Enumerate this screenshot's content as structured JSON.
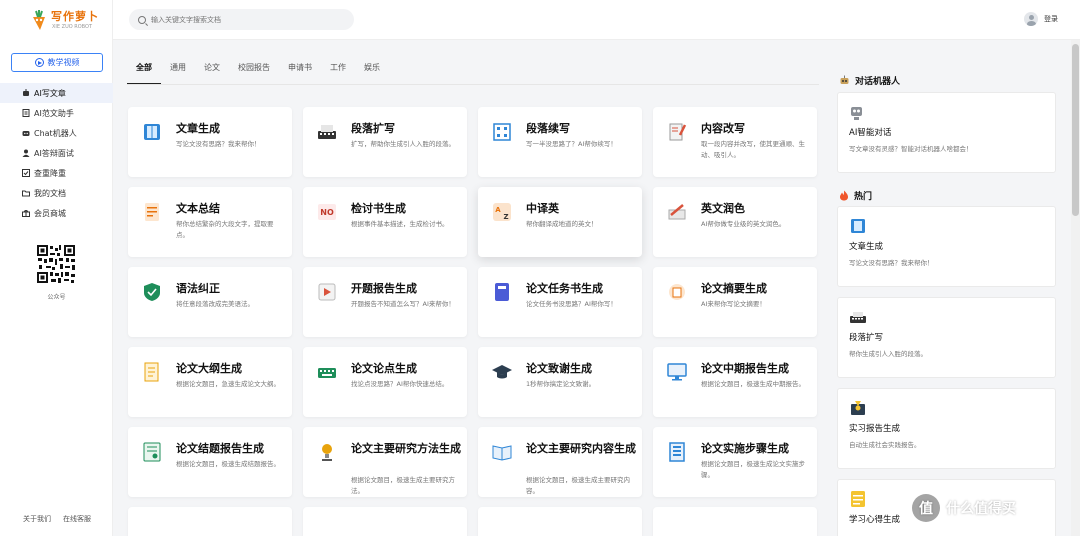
{
  "brand": {
    "title": "写作萝卜",
    "subtitle": "XIE ZUO ROBOT"
  },
  "sidebar": {
    "video_button": "教学视频",
    "items": [
      {
        "label": "AI写文章",
        "icon": "robot-icon"
      },
      {
        "label": "AI范文助手",
        "icon": "document-icon"
      },
      {
        "label": "Chat机器人",
        "icon": "chat-bot-icon"
      },
      {
        "label": "AI答辩面试",
        "icon": "user-icon"
      },
      {
        "label": "查重降重",
        "icon": "check-icon"
      },
      {
        "label": "我的文档",
        "icon": "folder-icon"
      },
      {
        "label": "会员商城",
        "icon": "gift-icon"
      }
    ],
    "qr_label": "公众号",
    "footer": {
      "about": "关于我们",
      "report": "在线客服"
    }
  },
  "topbar": {
    "search_placeholder": "输入关键文字搜索文档",
    "login": "登录"
  },
  "tabs": [
    "全部",
    "通用",
    "论文",
    "校园报告",
    "申请书",
    "工作",
    "娱乐"
  ],
  "cards": [
    {
      "title": "文章生成",
      "desc": "写论文没有思路？我来帮你！",
      "icon": "book-icon",
      "color": "#2f86d6"
    },
    {
      "title": "段落扩写",
      "desc": "扩写，帮助你生成引人入胜的段落。",
      "icon": "typewriter-icon",
      "color": "#333333"
    },
    {
      "title": "段落续写",
      "desc": "写一半没思路了？AI帮你续写！",
      "icon": "grid-icon",
      "color": "#2f86d6"
    },
    {
      "title": "内容改写",
      "desc": "取一段内容并改写，使其更通顺、生动、吸引人。",
      "icon": "edit-icon",
      "color": "#d9533c"
    },
    {
      "title": "文本总结",
      "desc": "帮你总结繁杂的大段文字，提取要点。",
      "icon": "summary-icon",
      "color": "#e8730c"
    },
    {
      "title": "检讨书生成",
      "desc": "根据事件基本描述，生成检讨书。",
      "icon": "no-icon",
      "color": "#c0392b"
    },
    {
      "title": "中译英",
      "desc": "帮你翻译成地道的英文！",
      "icon": "translate-icon",
      "color": "#e8730c"
    },
    {
      "title": "英文润色",
      "desc": "AI帮你做专业级的英文润色。",
      "icon": "pen-paper-icon",
      "color": "#555555"
    },
    {
      "title": "语法纠正",
      "desc": "将任意段落改成完美语法。",
      "icon": "shield-icon",
      "color": "#1e8e5a"
    },
    {
      "title": "开题报告生成",
      "desc": "开题报告不知道怎么写？AI来帮你！",
      "icon": "report-icon",
      "color": "#d9533c"
    },
    {
      "title": "论文任务书生成",
      "desc": "论文任务书没思路？AI帮你写！",
      "icon": "notebook-icon",
      "color": "#4b5bd6"
    },
    {
      "title": "论文摘要生成",
      "desc": "AI来帮你写论文摘要！",
      "icon": "abstract-icon",
      "color": "#e8730c"
    },
    {
      "title": "论文大纲生成",
      "desc": "根据论文题目，急速生成论文大纲。",
      "icon": "outline-icon",
      "color": "#e8a30c"
    },
    {
      "title": "论文论点生成",
      "desc": "找论点没思路？AI帮你快速总结。",
      "icon": "keyboard-icon",
      "color": "#1e8e5a"
    },
    {
      "title": "论文致谢生成",
      "desc": "1秒帮你搞定论文致谢。",
      "icon": "graduation-cap-icon",
      "color": "#2c3e50"
    },
    {
      "title": "论文中期报告生成",
      "desc": "根据论文题目，极速生成中期报告。",
      "icon": "monitor-icon",
      "color": "#2f86d6"
    },
    {
      "title": "论文结题报告生成",
      "desc": "根据论文题目，极速生成结题报告。",
      "icon": "certificate-icon",
      "color": "#1e8e5a"
    },
    {
      "title": "论文主要研究方法生成",
      "desc": "根据论文题目，极速生成主要研究方法。",
      "icon": "lamp-icon",
      "color": "#e8a30c"
    },
    {
      "title": "论文主要研究内容生成",
      "desc": "根据论文题目，极速生成主要研究内容。",
      "icon": "open-book-icon",
      "color": "#2f86d6"
    },
    {
      "title": "论文实施步骤生成",
      "desc": "根据论文题目，极速生成论文实施步骤。",
      "icon": "steps-icon",
      "color": "#2f86d6"
    }
  ],
  "right": {
    "chat_title": "对话机器人",
    "chat_card": {
      "title": "AI智能对话",
      "desc": "写文章没有灵感？智能对话机器人啥都会！"
    },
    "hot_title": "热门",
    "hot_cards": [
      {
        "title": "文章生成",
        "desc": "写论文没有思路？我来帮你！"
      },
      {
        "title": "段落扩写",
        "desc": "帮你生成引人入胜的段落。"
      },
      {
        "title": "实习报告生成",
        "desc": "自动生成社会实践报告。"
      },
      {
        "title": "学习心得生成",
        "desc": ""
      }
    ]
  },
  "watermark": {
    "glyph": "值",
    "text": "什么值得买"
  }
}
